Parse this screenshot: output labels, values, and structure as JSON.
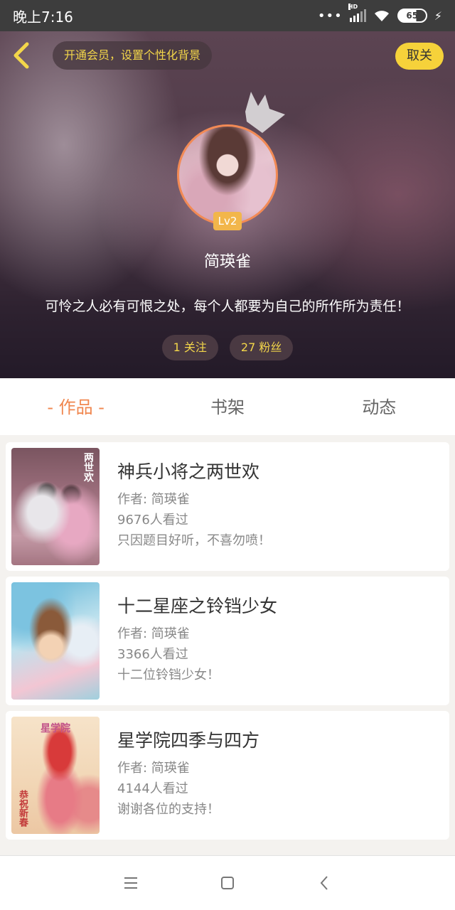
{
  "status_bar": {
    "time": "晚上7:16",
    "dots": "•••",
    "network_label": "HD",
    "battery_level": "65",
    "icons": [
      "signal-icon",
      "wifi-icon",
      "battery-icon",
      "charging-icon"
    ]
  },
  "header": {
    "back_icon": "chevron-left-icon",
    "vip_prompt": "开通会员，设置个性化背景",
    "unfollow_label": "取关",
    "level": "Lv2",
    "nickname": "简瑛雀",
    "bio": "可怜之人必有可恨之处，每个人都要为自己的所作所为责任！",
    "following": "1 关注",
    "followers": "27 粉丝",
    "accent_color": "#f6d23a"
  },
  "tabs": [
    {
      "label": "- 作品 -",
      "active": true
    },
    {
      "label": "书架",
      "active": false
    },
    {
      "label": "动态",
      "active": false
    }
  ],
  "works": [
    {
      "title": "神兵小将之两世欢",
      "author": "作者: 简瑛雀",
      "views": "9676人看过",
      "desc": "只因题目好听，不喜勿喷！",
      "cover_text": "两世欢"
    },
    {
      "title": "十二星座之铃铛少女",
      "author": "作者: 简瑛雀",
      "views": "3366人看过",
      "desc": "十二位铃铛少女！"
    },
    {
      "title": "星学院四季与四方",
      "author": "作者: 简瑛雀",
      "views": "4144人看过",
      "desc": "谢谢各位的支持！",
      "cover_title": "星学院",
      "cover_text": "恭祝新春"
    }
  ],
  "bottom_nav": {
    "icons": [
      "menu-icon",
      "home-icon",
      "back-icon"
    ]
  }
}
